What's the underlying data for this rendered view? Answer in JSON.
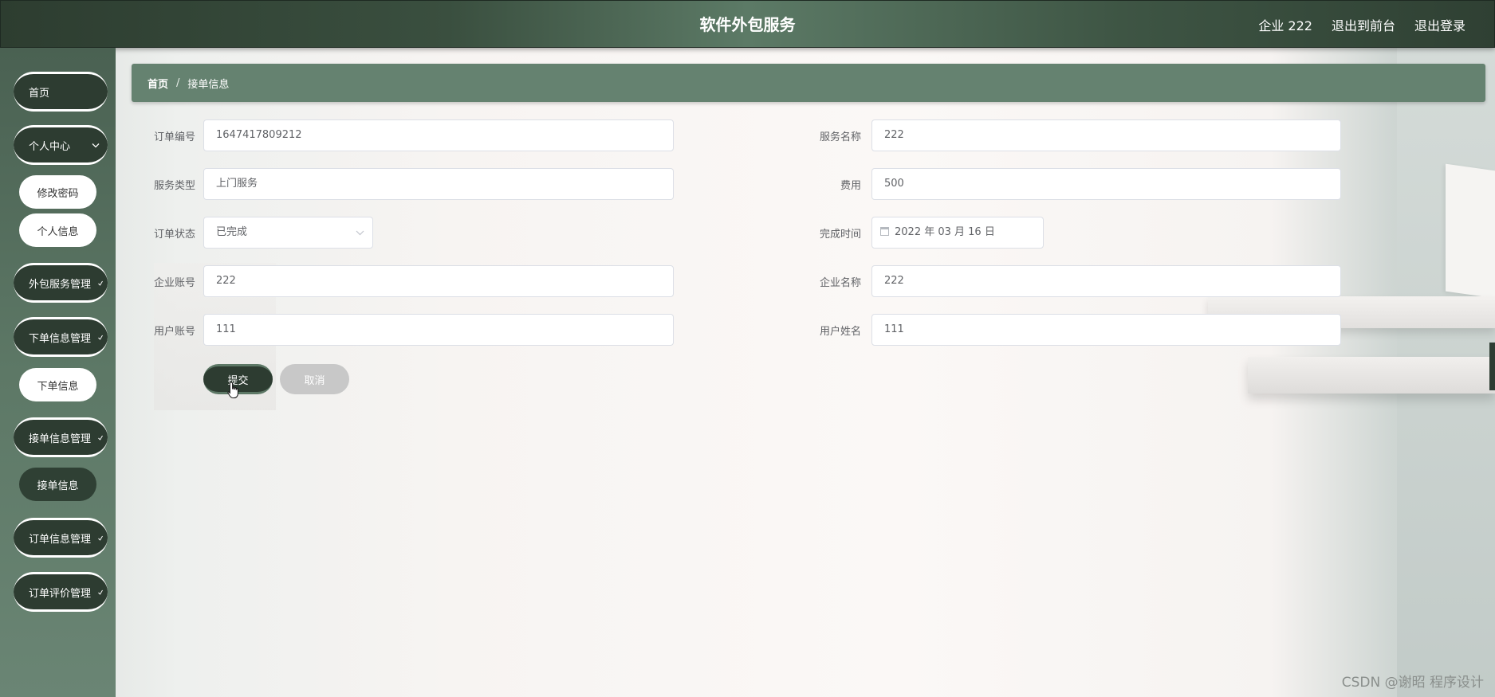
{
  "header": {
    "title": "软件外包服务",
    "user": "企业 222",
    "exit_front": "退出到前台",
    "logout": "退出登录"
  },
  "sidebar": {
    "items": [
      {
        "label": "首页"
      },
      {
        "label": "个人中心",
        "chevron": "chevron-down-icon"
      },
      {
        "label": "修改密码"
      },
      {
        "label": "个人信息"
      },
      {
        "label": "外包服务管理"
      },
      {
        "label": "下单信息管理"
      },
      {
        "label": "下单信息"
      },
      {
        "label": "接单信息管理"
      },
      {
        "label": "接单信息",
        "active": true
      },
      {
        "label": "订单信息管理"
      },
      {
        "label": "订单评价管理"
      }
    ],
    "chevron_glyph": "⌄",
    "small_check": "✓"
  },
  "breadcrumb": {
    "home": "首页",
    "separator": "/",
    "current": "接单信息"
  },
  "form": {
    "order_no": {
      "label": "订单编号",
      "value": "1647417809212"
    },
    "service_name": {
      "label": "服务名称",
      "value": "222"
    },
    "service_type": {
      "label": "服务类型",
      "value": "上门服务"
    },
    "fee": {
      "label": "费用",
      "value": "500"
    },
    "order_status": {
      "label": "订单状态",
      "value": "已完成"
    },
    "finish_time": {
      "label": "完成时间",
      "value": "2022 年 03 月 16 日"
    },
    "company_account": {
      "label": "企业账号",
      "value": "222"
    },
    "company_name": {
      "label": "企业名称",
      "value": "222"
    },
    "user_account": {
      "label": "用户账号",
      "value": "111"
    },
    "user_name": {
      "label": "用户姓名",
      "value": "111"
    },
    "submit": "提交",
    "cancel": "取消"
  },
  "watermark": "CSDN @谢昭  程序设计",
  "colors": {
    "primary": "#2d3c31",
    "sidebar": "#5d7866",
    "breadcrumb": "#658270",
    "cancel": "#c8c8c8"
  }
}
